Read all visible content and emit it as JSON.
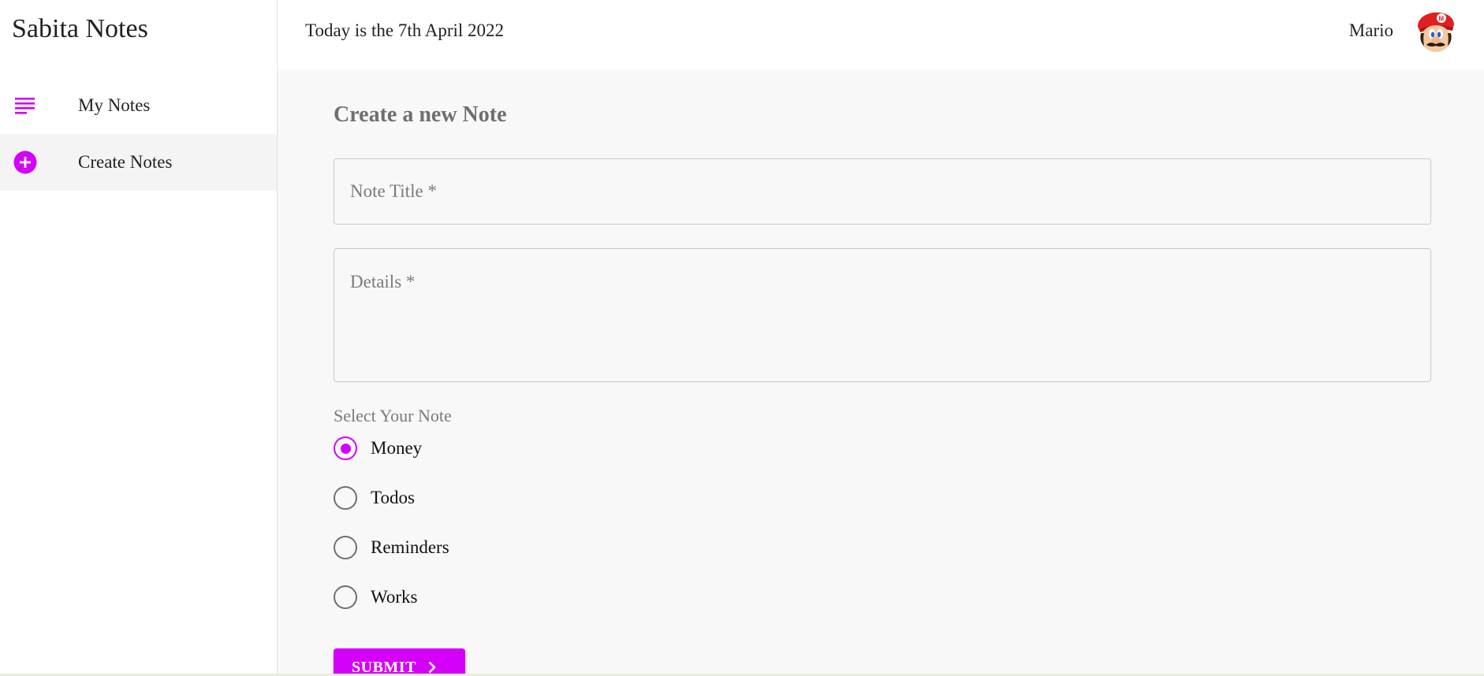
{
  "app": {
    "brand": "Sabita Notes",
    "accent_color": "#d500f9"
  },
  "sidebar": {
    "items": [
      {
        "label": "My Notes",
        "icon": "subject-icon",
        "active": false
      },
      {
        "label": "Create Notes",
        "icon": "add-circle-icon",
        "active": true
      }
    ]
  },
  "header": {
    "date_text": "Today is the 7th April 2022",
    "user_name": "Mario",
    "avatar": "mario-avatar"
  },
  "form": {
    "title": "Create a new Note",
    "note_title": {
      "placeholder": "Note Title *",
      "value": ""
    },
    "details": {
      "placeholder": "Details *",
      "value": ""
    },
    "category_label": "Select Your Note",
    "categories": [
      {
        "label": "Money",
        "selected": true
      },
      {
        "label": "Todos",
        "selected": false
      },
      {
        "label": "Reminders",
        "selected": false
      },
      {
        "label": "Works",
        "selected": false
      }
    ],
    "submit_label": "SUBMIT",
    "submit_icon": "chevron-right-icon"
  }
}
